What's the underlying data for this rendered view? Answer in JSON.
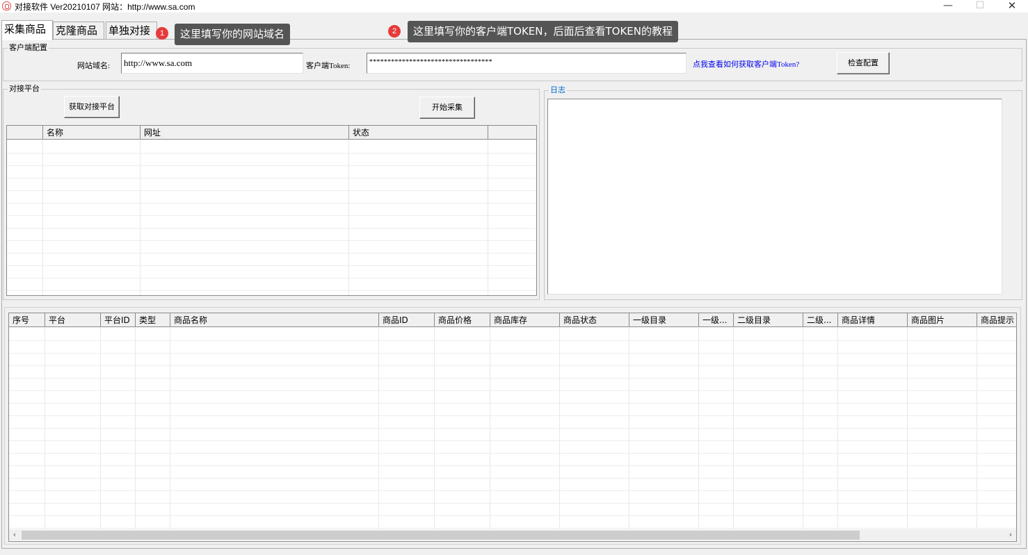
{
  "window": {
    "title": "对接软件 Ver20210107 网站：http://www.sa.com",
    "minimize": "—",
    "maximize": "☐",
    "close": "✕"
  },
  "tabs": [
    {
      "label": "采集商品"
    },
    {
      "label": "克隆商品"
    },
    {
      "label": "单独对接"
    }
  ],
  "tips": [
    {
      "num": "1",
      "text": "这里填写你的网站域名"
    },
    {
      "num": "2",
      "text": "这里填写你的客户端TOKEN，后面后查看TOKEN的教程"
    }
  ],
  "client_config": {
    "legend": "客户端配置",
    "domain_label": "网站域名:",
    "domain_value": "http://www.sa.com",
    "token_label": "客户端Token:",
    "token_value": "**********************************",
    "help_link": "点我查看如何获取客户端Token?",
    "check_button": "检查配置"
  },
  "platform": {
    "legend": "对接平台",
    "fetch_button": "获取对接平台",
    "start_button": "开始采集",
    "columns": [
      "",
      "名称",
      "网址",
      "状态",
      ""
    ]
  },
  "log": {
    "legend": "日志"
  },
  "products": {
    "columns": [
      "序号",
      "平台",
      "平台ID",
      "类型",
      "商品名称",
      "商品ID",
      "商品价格",
      "商品库存",
      "商品状态",
      "一级目录",
      "一级...",
      "二级目录",
      "二级...",
      "商品详情",
      "商品图片",
      "商品提示"
    ]
  },
  "scroll": {
    "left": "‹",
    "right": "›"
  }
}
